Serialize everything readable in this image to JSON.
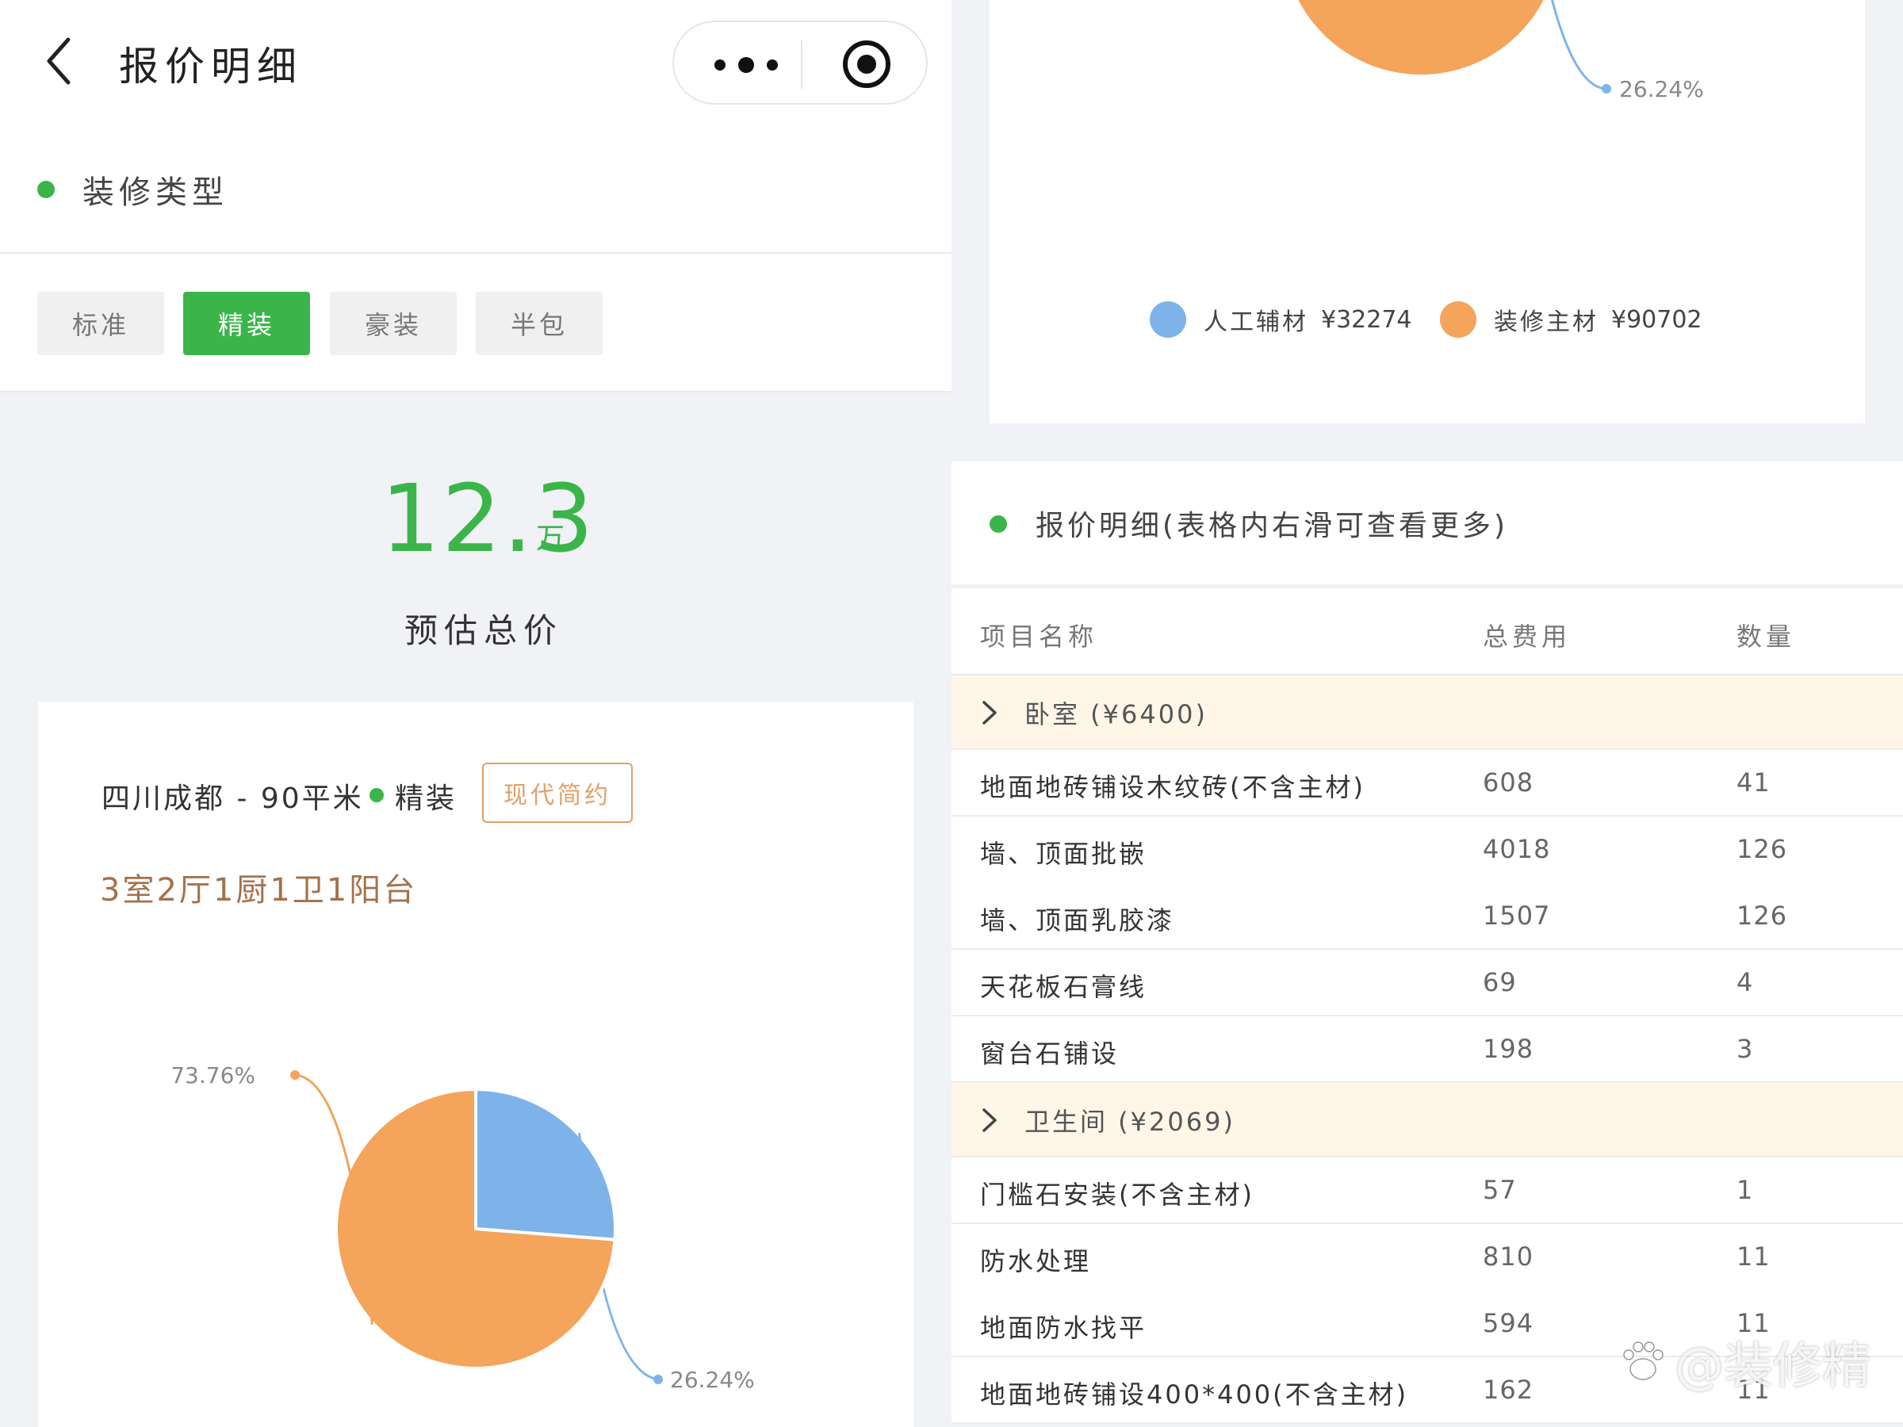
{
  "header": {
    "title": "报价明细"
  },
  "decoration_type": {
    "title": "装修类型",
    "options": [
      "标准",
      "精装",
      "豪装",
      "半包"
    ],
    "selected": "精装"
  },
  "estimate": {
    "amount": "12.3",
    "unit": "万",
    "label": "预估总价"
  },
  "project": {
    "location": "四川成都 - 90平米",
    "level": "精装",
    "style": "现代简约",
    "layout": "3室2厅1厨1卫1阳台"
  },
  "colors": {
    "accent": "#3bb54a",
    "labor": "#7eb3ea",
    "material": "#f4a45b",
    "group_bg": "#fff6e8"
  },
  "chart_data": {
    "type": "pie",
    "slices": [
      {
        "name": "人工辅材",
        "value": 32274,
        "percent": 26.24,
        "percent_label": "26.24%",
        "color": "#7eb3ea"
      },
      {
        "name": "装修主材",
        "value": 90702,
        "percent": 73.76,
        "percent_label": "73.76%",
        "color": "#f4a45b"
      }
    ],
    "legend": [
      {
        "label": "人工辅材",
        "value": "¥32274"
      },
      {
        "label": "装修主材",
        "value": "¥90702"
      }
    ],
    "legend_position": "bottom"
  },
  "detail": {
    "title": "报价明细(表格内右滑可查看更多)",
    "columns": [
      "项目名称",
      "总费用",
      "数量"
    ],
    "groups": [
      {
        "label": "卧室 (¥6400)",
        "rows": [
          {
            "name": "地面地砖铺设木纹砖(不含主材)",
            "cost": "608",
            "qty": "41"
          },
          {
            "name": "墙、顶面批嵌",
            "cost": "4018",
            "qty": "126"
          },
          {
            "name": "墙、顶面乳胶漆",
            "cost": "1507",
            "qty": "126"
          },
          {
            "name": "天花板石膏线",
            "cost": "69",
            "qty": "4"
          },
          {
            "name": "窗台石铺设",
            "cost": "198",
            "qty": "3"
          }
        ]
      },
      {
        "label": "卫生间 (¥2069)",
        "rows": [
          {
            "name": "门槛石安装(不含主材)",
            "cost": "57",
            "qty": "1"
          },
          {
            "name": "防水处理",
            "cost": "810",
            "qty": "11"
          },
          {
            "name": "地面防水找平",
            "cost": "594",
            "qty": "11"
          },
          {
            "name": "地面地砖铺设400*400(不含主材)",
            "cost": "162",
            "qty": "11"
          }
        ]
      }
    ]
  },
  "watermark": "@装修精"
}
